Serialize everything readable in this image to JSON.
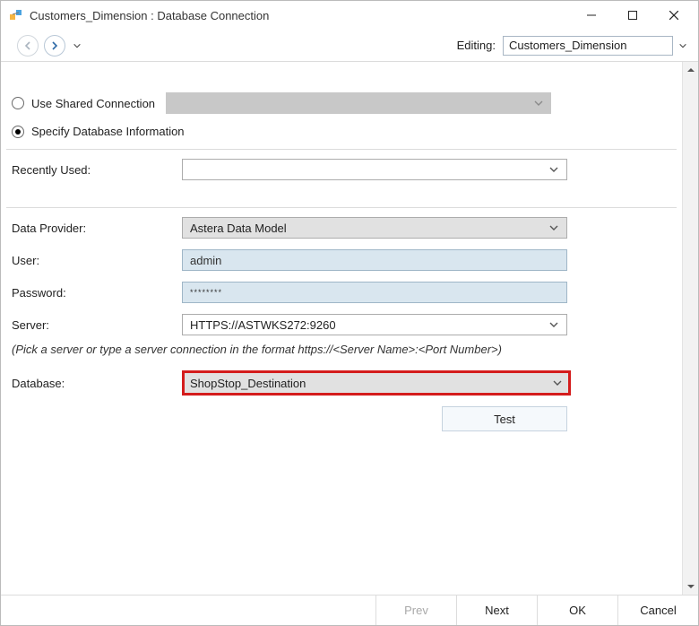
{
  "window": {
    "title": "Customers_Dimension : Database Connection"
  },
  "toolbar": {
    "editing_label": "Editing:",
    "editing_value": "Customers_Dimension"
  },
  "radios": {
    "use_shared": "Use Shared Connection",
    "specify_db": "Specify Database Information"
  },
  "fields": {
    "recently_used_label": "Recently Used:",
    "recently_used_value": "",
    "data_provider_label": "Data Provider:",
    "data_provider_value": "Astera Data Model",
    "user_label": "User:",
    "user_value": "admin",
    "password_label": "Password:",
    "password_value": "********",
    "server_label": "Server:",
    "server_value": "HTTPS://ASTWKS272:9260",
    "server_hint": "(Pick a server or type a server connection in the format  https://<Server Name>:<Port Number>)",
    "database_label": "Database:",
    "database_value": "ShopStop_Destination"
  },
  "buttons": {
    "test": "Test",
    "prev": "Prev",
    "next": "Next",
    "ok": "OK",
    "cancel": "Cancel"
  }
}
